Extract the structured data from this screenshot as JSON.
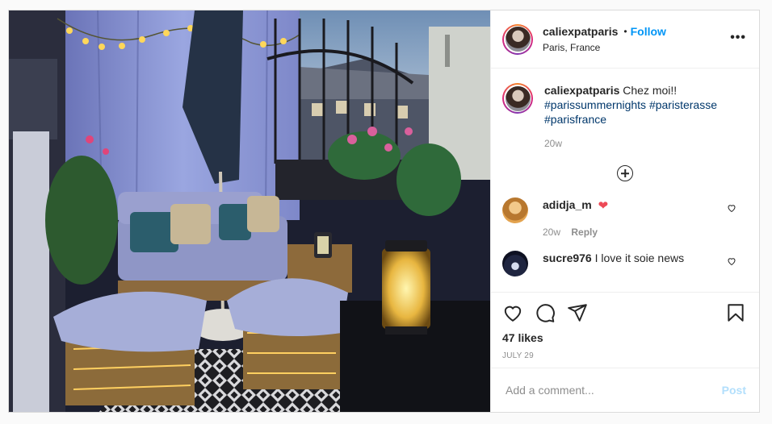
{
  "post": {
    "username": "caliexpatparis",
    "follow_label": "Follow",
    "separator": "•",
    "location": "Paris, France",
    "more_label": "•••"
  },
  "caption": {
    "username": "caliexpatparis",
    "text": "Chez moi!!",
    "hashtags": [
      "#parissummernights",
      "#paristerasse",
      "#parisfrance"
    ],
    "time": "20w"
  },
  "comments": [
    {
      "username": "adidja_m",
      "text": "",
      "emoji": "❤",
      "time": "20w",
      "reply_label": "Reply"
    },
    {
      "username": "sucre976",
      "text": "I love it soie news"
    }
  ],
  "actions": {
    "likes": "47 likes",
    "date": "JULY 29"
  },
  "add_comment": {
    "placeholder": "Add a comment...",
    "post_label": "Post"
  },
  "colors": {
    "link": "#0095f6",
    "hashtag": "#00376b",
    "secondary_text": "#8e8e8e",
    "heart_red": "#ed4956",
    "post_disabled": "#b2dffc"
  },
  "icons": [
    "more-options-icon",
    "load-more-comments-icon",
    "like-icon",
    "comment-icon",
    "share-icon",
    "save-icon",
    "comment-like-icon"
  ]
}
